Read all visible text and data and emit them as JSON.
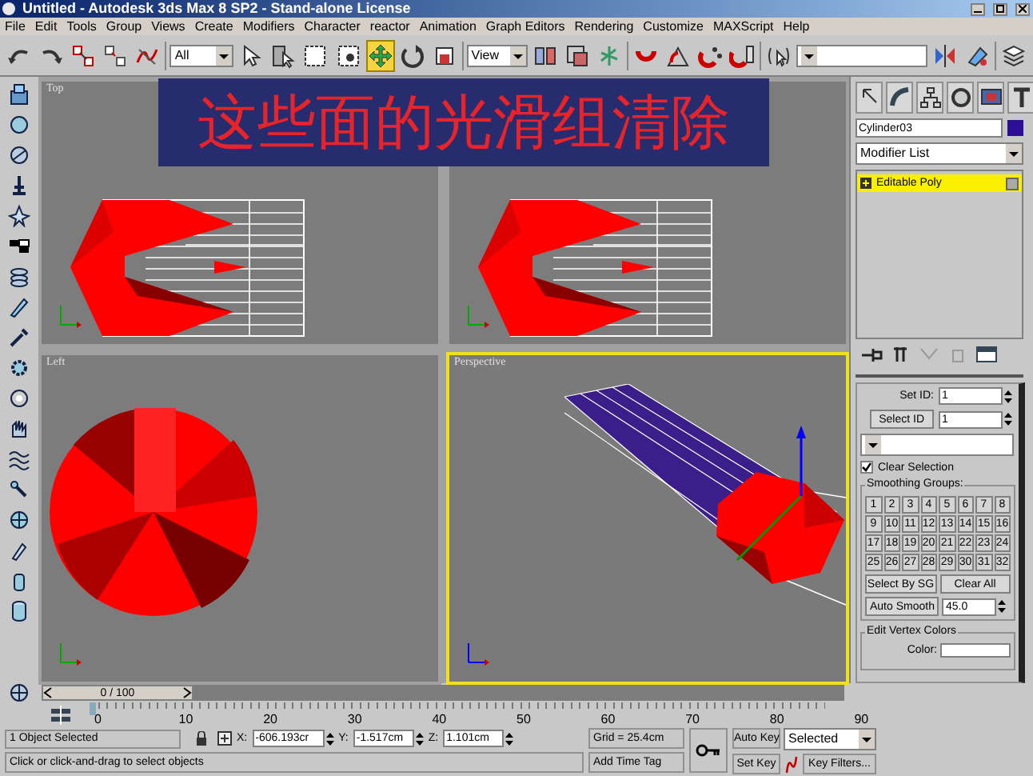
{
  "window": {
    "title": "Untitled - Autodesk 3ds Max 8 SP2  - Stand-alone License"
  },
  "menu": [
    "File",
    "Edit",
    "Tools",
    "Group",
    "Views",
    "Create",
    "Modifiers",
    "Character",
    "reactor",
    "Animation",
    "Graph Editors",
    "Rendering",
    "Customize",
    "MAXScript",
    "Help"
  ],
  "toolbar": {
    "selection_filter": "All",
    "reference_coord": "View",
    "tools": [
      {
        "kind": "undo",
        "selected": false
      },
      {
        "kind": "redo",
        "selected": false
      },
      {
        "kind": "link",
        "selected": false
      },
      {
        "kind": "unlink",
        "selected": false
      },
      {
        "kind": "bind",
        "selected": false
      },
      {
        "kind": "filter",
        "selected": false
      },
      {
        "kind": "arrow",
        "selected": false
      },
      {
        "kind": "byname",
        "selected": false
      },
      {
        "kind": "region",
        "selected": false
      },
      {
        "kind": "crossing",
        "selected": false
      },
      {
        "kind": "move",
        "selected": true
      },
      {
        "kind": "rotate",
        "selected": false
      },
      {
        "kind": "scale",
        "selected": false
      },
      {
        "kind": "coord",
        "selected": false
      },
      {
        "kind": "pivot",
        "selected": false
      },
      {
        "kind": "manipulate",
        "selected": false
      },
      {
        "kind": "snap",
        "selected": false
      },
      {
        "kind": "angle",
        "selected": false
      },
      {
        "kind": "percent",
        "selected": false
      },
      {
        "kind": "spinner",
        "selected": false
      },
      {
        "kind": "named",
        "selected": false
      },
      {
        "kind": "namedsel",
        "selected": false
      },
      {
        "kind": "mirror",
        "selected": false
      },
      {
        "kind": "align",
        "selected": false
      },
      {
        "kind": "layers",
        "selected": false
      }
    ]
  },
  "banner": "这些面的光滑组清除",
  "viewports": [
    {
      "label": "Top",
      "kind": "top",
      "active": false
    },
    {
      "kind": "front",
      "active": false
    },
    {
      "label": "Left",
      "kind": "left",
      "active": false
    },
    {
      "label": "Perspective",
      "kind": "perspective",
      "active": true
    }
  ],
  "command_panel": {
    "object_name": "Cylinder03",
    "modifier_list": "Modifier List",
    "stack": [
      {
        "label": "Editable Poly",
        "selected": true
      }
    ],
    "set_id": {
      "label": "Set ID:",
      "value": "1"
    },
    "select_id": {
      "button": "Select ID",
      "value": "1"
    },
    "clear_selection": {
      "label": "Clear Selection",
      "checked": true
    },
    "smoothing_groups": {
      "title": "Smoothing Groups:",
      "buttons": [
        "1",
        "2",
        "3",
        "4",
        "5",
        "6",
        "7",
        "8",
        "9",
        "10",
        "11",
        "12",
        "13",
        "14",
        "15",
        "16",
        "17",
        "18",
        "19",
        "20",
        "21",
        "22",
        "23",
        "24",
        "25",
        "26",
        "27",
        "28",
        "29",
        "30",
        "31",
        "32"
      ]
    },
    "select_by_sg": "Select By SG",
    "clear_all": "Clear All",
    "auto_smooth": {
      "button": "Auto Smooth",
      "value": "45.0"
    },
    "edit_vertex_colors": {
      "title": "Edit Vertex Colors",
      "color_label": "Color:"
    }
  },
  "timeline": {
    "frame": "0 / 100",
    "level": 0,
    "ticks": [
      "0",
      "10",
      "20",
      "30",
      "40",
      "50",
      "60",
      "70",
      "80",
      "90"
    ]
  },
  "status_bar": {
    "selection": "1 Object Selected",
    "x_label": "X:",
    "x": "-606.193cr",
    "y_label": "Y:",
    "y": "-1.517cm",
    "z_label": "Z:",
    "z": "1.101cm",
    "grid": "Grid = 25.4cm",
    "prompt": "Click or click-and-drag to select objects",
    "add_time_tag": "Add Time Tag",
    "auto_key": "Auto Key",
    "key_mode": "Selected",
    "set_key": "Set Key",
    "key_filters": "Key Filters..."
  }
}
